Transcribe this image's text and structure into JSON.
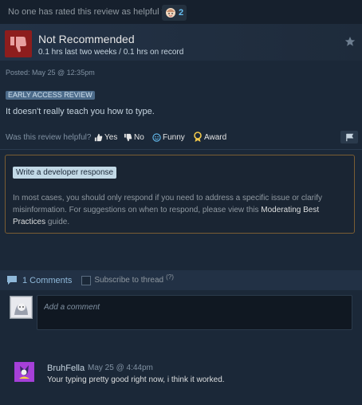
{
  "topbar": {
    "helpful_text": "No one has rated this review as helpful yet",
    "reaction_count": "2"
  },
  "review": {
    "verdict": "Not Recommended",
    "hours": "0.1 hrs last two weeks / 0.1 hrs on record",
    "posted": "Posted: May 25 @ 12:35pm",
    "badge": "EARLY ACCESS REVIEW",
    "body": "It doesn't really teach you how to type."
  },
  "helpful": {
    "question": "Was this review helpful?",
    "yes": "Yes",
    "no": "No",
    "funny": "Funny",
    "award": "Award"
  },
  "developer": {
    "button": "Write a developer response",
    "text_before": "In most cases, you should only respond if you need to address a specific issue or clarify misinformation. For suggestions on when to respond, please view this ",
    "link": "Moderating Best Practices",
    "text_after": " guide."
  },
  "comments": {
    "count_label": "1 Comments",
    "subscribe": "Subscribe to thread",
    "help": "(?)",
    "placeholder": "Add a comment",
    "items": [
      {
        "author": "BruhFella",
        "time": "May 25 @ 4:44pm",
        "text": "Your typing pretty good right now, i think it worked."
      }
    ]
  },
  "colors": {
    "background": "#1b2838",
    "thumb_down": "#8d1d1d",
    "accent": "#66c0f4",
    "dev_border": "#7a5d33"
  }
}
